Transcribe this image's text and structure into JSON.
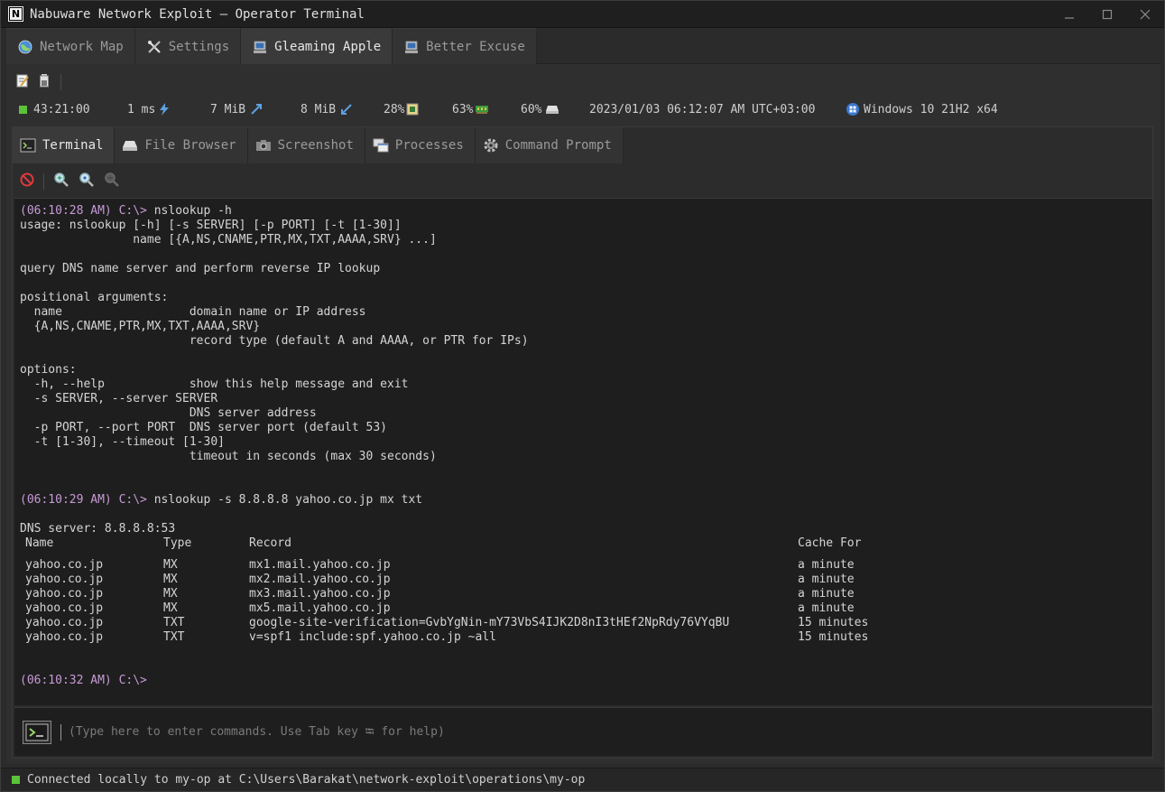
{
  "window": {
    "title": "Nabuware Network Exploit — Operator Terminal",
    "logo_letter": "N"
  },
  "outer_tabs": [
    {
      "label": "Network Map",
      "icon": "globe-icon"
    },
    {
      "label": "Settings",
      "icon": "tools-icon"
    },
    {
      "label": "Gleaming Apple",
      "icon": "computer-icon",
      "active": true
    },
    {
      "label": "Better Excuse",
      "icon": "computer-icon"
    }
  ],
  "status": {
    "uptime": "43:21:00",
    "latency": "1 ms",
    "upload": "7 MiB",
    "download": "8 MiB",
    "cpu": "28%",
    "memory": "63%",
    "disk": "60%",
    "datetime": "2023/01/03 06:12:07 AM UTC+03:00",
    "os": "Windows 10 21H2 x64",
    "colors": {
      "ok": "#5cc23a"
    }
  },
  "inner_tabs": [
    {
      "label": "Terminal",
      "icon": "terminal-icon",
      "active": true
    },
    {
      "label": "File Browser",
      "icon": "drive-icon"
    },
    {
      "label": "Screenshot",
      "icon": "camera-icon"
    },
    {
      "label": "Processes",
      "icon": "windows-stack-icon"
    },
    {
      "label": "Command Prompt",
      "icon": "gear-icon"
    }
  ],
  "terminal": {
    "block1": {
      "prompt": "(06:10:28 AM) C:\\>",
      "command": " nslookup -h",
      "help": [
        "usage: nslookup [-h] [-s SERVER] [-p PORT] [-t [1-30]]",
        "                name [{A,NS,CNAME,PTR,MX,TXT,AAAA,SRV} ...]",
        "",
        "query DNS name server and perform reverse IP lookup",
        "",
        "positional arguments:",
        "  name                  domain name or IP address",
        "  {A,NS,CNAME,PTR,MX,TXT,AAAA,SRV}",
        "                        record type (default A and AAAA, or PTR for IPs)",
        "",
        "options:",
        "  -h, --help            show this help message and exit",
        "  -s SERVER, --server SERVER",
        "                        DNS server address",
        "  -p PORT, --port PORT  DNS server port (default 53)",
        "  -t [1-30], --timeout [1-30]",
        "                        timeout in seconds (max 30 seconds)"
      ]
    },
    "block2": {
      "prompt": "(06:10:29 AM) C:\\>",
      "command": " nslookup -s 8.8.8.8 yahoo.co.jp mx txt",
      "server_line": "DNS server: 8.8.8.8:53",
      "columns": [
        "Name",
        "Type",
        "Record",
        "Cache For"
      ],
      "rows": [
        [
          "yahoo.co.jp",
          "MX",
          "mx1.mail.yahoo.co.jp",
          "a minute"
        ],
        [
          "yahoo.co.jp",
          "MX",
          "mx2.mail.yahoo.co.jp",
          "a minute"
        ],
        [
          "yahoo.co.jp",
          "MX",
          "mx3.mail.yahoo.co.jp",
          "a minute"
        ],
        [
          "yahoo.co.jp",
          "MX",
          "mx5.mail.yahoo.co.jp",
          "a minute"
        ],
        [
          "yahoo.co.jp",
          "TXT",
          "google-site-verification=GvbYgNin-mY73VbS4IJK2D8nI3tHEf2NpRdy76VYqBU",
          "15 minutes"
        ],
        [
          "yahoo.co.jp",
          "TXT",
          "v=spf1 include:spf.yahoo.co.jp ~all",
          "15 minutes"
        ]
      ]
    },
    "block3": {
      "prompt": "(06:10:32 AM) C:\\>"
    }
  },
  "command_input": {
    "placeholder": "(Type here to enter commands. Use Tab key ⭾ for help)"
  },
  "statusbar": {
    "text": "Connected locally to my-op at C:\\Users\\Barakat\\network-exploit\\operations\\my-op"
  }
}
